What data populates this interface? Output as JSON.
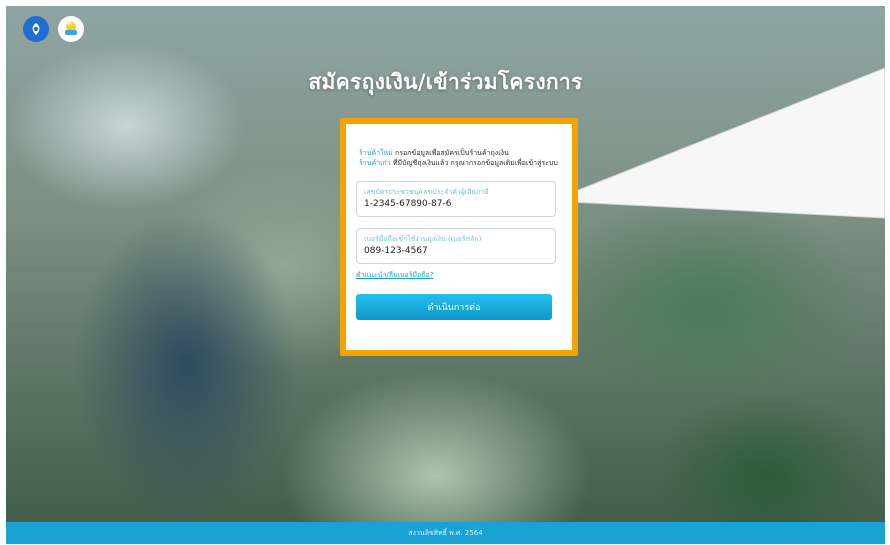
{
  "header": {
    "title": "สมัครถุงเงิน/เข้าร่วมโครงการ",
    "logos": [
      "bank-logo-icon",
      "thungngoen-logo-icon"
    ]
  },
  "form": {
    "intro_line1_highlight": "ร้านค้าใหม่",
    "intro_line1_text": " กรอกข้อมูลเพื่อสมัครเป็นร้านค้าถุงเงิน",
    "intro_line2_highlight": "ร้านค้าเก่า",
    "intro_line2_text": " ที่มีบัญชีถุงเงินแล้ว กรุณากรอกข้อมูลเดิมเพื่อเข้าสู่ระบบ",
    "id_field": {
      "label": "เลขบัตรประชาชน/เลขประจำตัวผู้เสียภาษี",
      "value": "1-2345-67890-87-6"
    },
    "phone_field": {
      "label": "เบอร์มือถือเข้าใช้งานถุงเงิน (เบอร์หลัก)",
      "value": "089-123-4567"
    },
    "help_link": "คำแนะนำ/ลืมเบอร์มือถือ?",
    "submit_label": "ดำเนินการต่อ"
  },
  "footer": {
    "text": "สงวนลิขสิทธิ์ พ.ศ. 2564"
  },
  "colors": {
    "accent": "#17a2c9",
    "highlight_border": "#f5a300",
    "footer_bg": "#18a3d4"
  }
}
